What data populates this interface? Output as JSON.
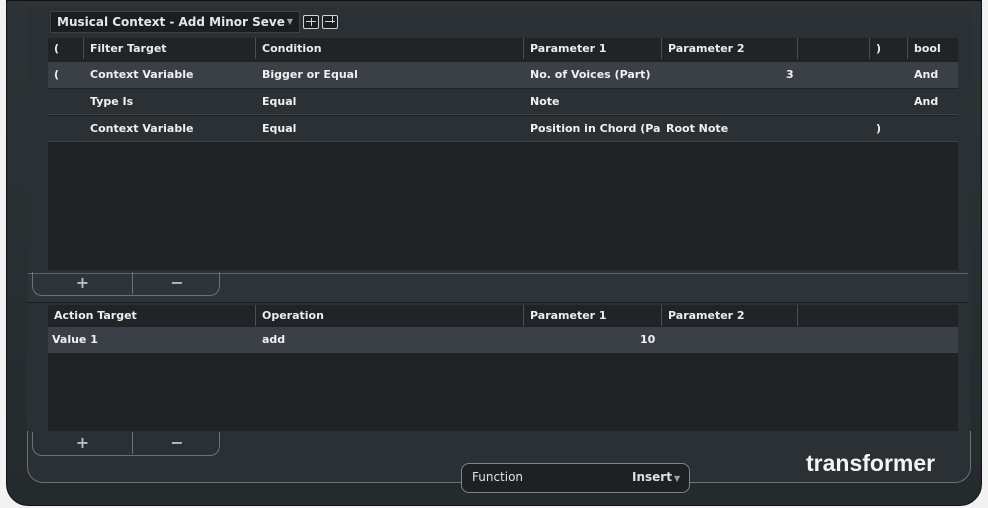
{
  "preset": {
    "name": "Musical Context - Add Minor Seve",
    "store_icon": "store-preset-icon",
    "remove_icon": "remove-preset-icon"
  },
  "filter": {
    "headers": [
      "(",
      "Filter Target",
      "Condition",
      "Parameter 1",
      "Parameter 2",
      "",
      ")",
      "bool"
    ],
    "rows": [
      {
        "open": "(",
        "target": "Context Variable",
        "condition": "Bigger or Equal",
        "param1": "No. of Voices (Part)",
        "param2": "3",
        "close": "",
        "bool": "And"
      },
      {
        "open": "",
        "target": "Type Is",
        "condition": "Equal",
        "param1": "Note",
        "param2": "",
        "close": "",
        "bool": "And"
      },
      {
        "open": "",
        "target": "Context Variable",
        "condition": "Equal",
        "param1": "Position in Chord (Pa",
        "param2": "Root Note",
        "close": ")",
        "bool": ""
      }
    ],
    "add_label": "+",
    "remove_label": "−"
  },
  "action": {
    "headers": [
      "Action Target",
      "Operation",
      "Parameter 1",
      "Parameter 2",
      ""
    ],
    "rows": [
      {
        "target": "Value 1",
        "operation": "add",
        "param1": "10",
        "param2": ""
      }
    ],
    "add_label": "+",
    "remove_label": "−"
  },
  "function": {
    "label": "Function",
    "value": "Insert"
  },
  "brand": "transformer"
}
